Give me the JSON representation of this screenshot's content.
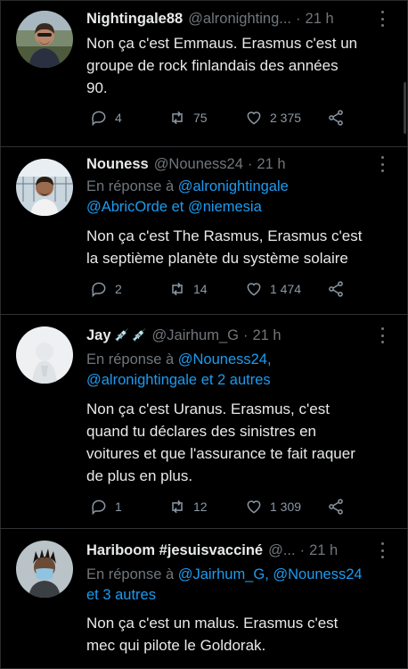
{
  "tweets": [
    {
      "name": "Nightingale88",
      "handle": "@alronighting...",
      "time": "21 h",
      "text_lines": [
        "Non ça c'est Emmaus. Erasmus c'est un",
        "groupe de rock finlandais des années",
        "90."
      ],
      "replies": "4",
      "retweets": "75",
      "likes": "2 375"
    },
    {
      "name": "Nouness",
      "handle": "@Nouness24",
      "time": "21 h",
      "reply_prefix": "En réponse à",
      "reply_line1_link": "@alronightingale",
      "reply_line2_link_a": "@AbricOrde",
      "reply_line2_mid": "et",
      "reply_line2_link_b": "@niemesia",
      "text_lines": [
        "Non ça c'est The Rasmus, Erasmus c'est",
        "la septième planète du système solaire"
      ],
      "replies": "2",
      "retweets": "14",
      "likes": "1 474"
    },
    {
      "name": "Jay",
      "name_emoji": "💉 💉",
      "handle": "@Jairhum_G",
      "time": "21 h",
      "reply_prefix": "En réponse à",
      "reply_line1_link": "@Nouness24,",
      "reply_line2_link_a": "@alronightingale",
      "reply_line2_rest": "et 2 autres",
      "text_lines": [
        "Non ça c'est Uranus. Erasmus, c'est",
        "quand tu déclares des sinistres en",
        "voitures et que l'assurance te fait raquer",
        "de plus en plus."
      ],
      "replies": "1",
      "retweets": "12",
      "likes": "1 309"
    },
    {
      "name": "Hariboom #jesuisvacciné",
      "handle": "@...",
      "time": "21 h",
      "reply_prefix": "En réponse à",
      "reply_line1_link": "@Jairhum_G, @Nouness24",
      "reply_line2_rest": "et 3 autres",
      "text_lines": [
        "Non ça c'est un malus. Erasmus c'est",
        "mec qui pilote le Goldorak."
      ]
    }
  ],
  "dot_separator": "·",
  "colors": {
    "background": "#000000",
    "text": "#e7e9ea",
    "muted": "#71767b",
    "link": "#1d9bf0"
  },
  "icons": [
    "reply-icon",
    "retweet-icon",
    "like-icon",
    "share-icon",
    "more-icon"
  ]
}
